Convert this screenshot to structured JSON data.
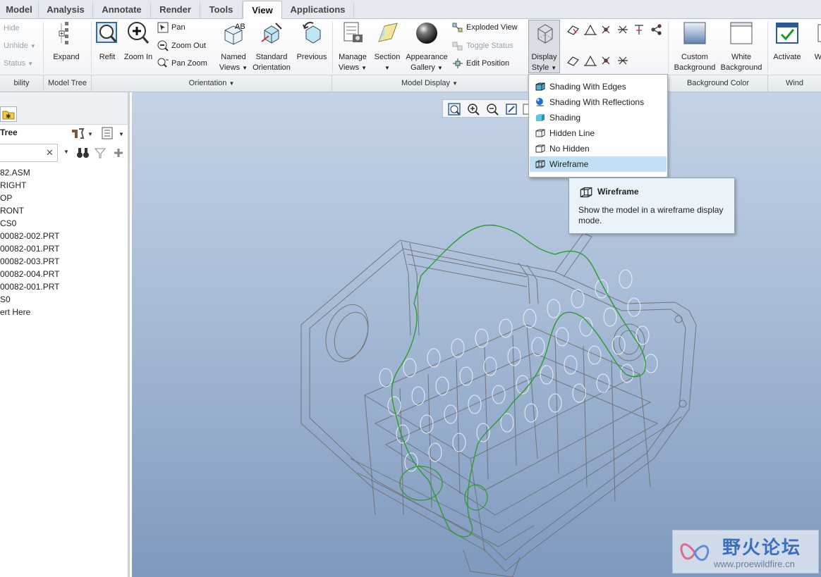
{
  "tabs": [
    {
      "label": "Model",
      "active": false
    },
    {
      "label": "Analysis",
      "active": false
    },
    {
      "label": "Annotate",
      "active": false
    },
    {
      "label": "Render",
      "active": false
    },
    {
      "label": "Tools",
      "active": false
    },
    {
      "label": "View",
      "active": true
    },
    {
      "label": "Applications",
      "active": false
    }
  ],
  "ribbon": {
    "visibility": {
      "hide": "Hide",
      "unhide": "Unhide",
      "status": "Status"
    },
    "expand": "Expand",
    "refit": "Refit",
    "zoom_in": "Zoom In",
    "pan": "Pan",
    "zoom_out": "Zoom Out",
    "pan_zoom": "Pan Zoom",
    "named_views": [
      "Named",
      "Views"
    ],
    "standard_orientation": [
      "Standard",
      "Orientation"
    ],
    "previous": "Previous",
    "manage_views": [
      "Manage",
      "Views"
    ],
    "section": "Section",
    "appearance_gallery": [
      "Appearance",
      "Gallery"
    ],
    "exploded_view": "Exploded View",
    "toggle_status": "Toggle Status",
    "edit_position": "Edit Position",
    "display_style": [
      "Display",
      "Style"
    ],
    "custom_background": [
      "Custom",
      "Background"
    ],
    "white_background": [
      "White",
      "Background"
    ],
    "activate": "Activate",
    "w": "W"
  },
  "groups": {
    "visibility": "bility",
    "model_tree": "Model Tree",
    "orientation": "Orientation",
    "model_display": "Model Display",
    "background_color": "Background Color",
    "window": "Wind"
  },
  "tree": {
    "title": "Tree",
    "items": [
      "82.ASM",
      "RIGHT",
      "OP",
      "RONT",
      "CS0",
      "00082-002.PRT",
      "00082-001.PRT",
      "00082-003.PRT",
      "00082-004.PRT",
      "00082-001.PRT",
      "S0",
      "ert Here"
    ]
  },
  "dropdown": {
    "items": [
      {
        "label": "Shading With Edges",
        "icon": "shading-edges-icon",
        "selected": false
      },
      {
        "label": "Shading With Reflections",
        "icon": "reflections-icon",
        "selected": false
      },
      {
        "label": "Shading",
        "icon": "shading-icon",
        "selected": false
      },
      {
        "label": "Hidden Line",
        "icon": "hidden-line-icon",
        "selected": false
      },
      {
        "label": "No Hidden",
        "icon": "no-hidden-icon",
        "selected": false
      },
      {
        "label": "Wireframe",
        "icon": "wireframe-icon",
        "selected": true
      }
    ]
  },
  "tooltip": {
    "title": "Wireframe",
    "body": "Show the model in a wireframe display mode."
  },
  "watermark": {
    "text_cn": "野火论坛",
    "url": "www.proewildfire.cn"
  },
  "colors": {
    "selection": "#bfe0f5",
    "wire": "#6e6e6e",
    "highlight": "#2a9d2a",
    "accent": "#3d6fbf"
  }
}
